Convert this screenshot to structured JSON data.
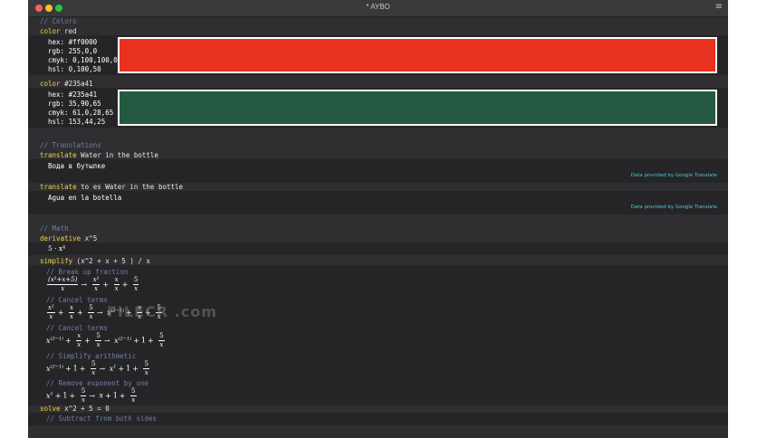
{
  "window": {
    "title": "* AYBO"
  },
  "colors": {
    "comment": "// Colors",
    "blocks": [
      {
        "keyword": "color",
        "arg": " red",
        "lines": [
          "hex: #ff0000",
          "rgb: 255,0,0",
          "cmyk: 0,100,100,0",
          "hsl: 0,100,50"
        ],
        "swatch": "#e8311f"
      },
      {
        "keyword": "color",
        "arg": " #235a41",
        "lines": [
          "hex: #235a41",
          "rgb: 35,90,65",
          "cmyk: 61,0,28,65",
          "hsl: 153,44,25"
        ],
        "swatch": "#235a41"
      }
    ]
  },
  "translations": {
    "comment": "// Translations",
    "blocks": [
      {
        "keyword": "translate",
        "arg": " Water in the bottle",
        "result": "Вода в бутылке",
        "credit": "Data provided by Google Translate"
      },
      {
        "keyword": "translate",
        "arg": " to es Water in the bottle",
        "result": "Agua en la botella",
        "credit": "Data provided by Google Translate"
      }
    ]
  },
  "math": {
    "comment": "// Math",
    "derivative": {
      "keyword": "derivative",
      "arg": " x^5",
      "result": "5 · x⁴"
    },
    "simplify": {
      "keyword": "simplify",
      "arg": " (x^2 + x + 5 ) / x",
      "steps": [
        "// Break up fraction",
        "// Cancel terms",
        "// Cancel terms",
        "// Simplify arithmetic",
        "// Remove exponent by one"
      ]
    },
    "solve": {
      "keyword": "solve",
      "arg": " x^2 + 5 = 0",
      "steps": [
        "// Subtract from both sides"
      ]
    }
  },
  "watermark": "FILECR .com"
}
